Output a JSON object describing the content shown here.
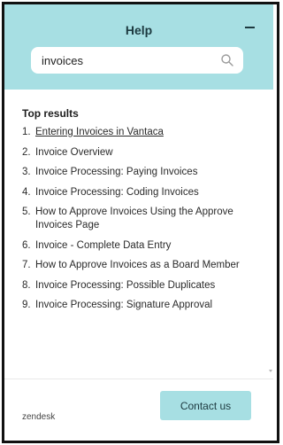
{
  "widget": {
    "title": "Help",
    "minimize_icon": "minus-icon"
  },
  "search": {
    "value": "invoices",
    "icon": "search-icon"
  },
  "results": {
    "heading": "Top results",
    "items": [
      {
        "number": "1.",
        "label": "Entering Invoices in Vantaca"
      },
      {
        "number": "2.",
        "label": "Invoice Overview"
      },
      {
        "number": "3.",
        "label": "Invoice Processing: Paying Invoices"
      },
      {
        "number": "4.",
        "label": "Invoice Processing: Coding Invoices"
      },
      {
        "number": "5.",
        "label": "How to Approve Invoices Using the Approve Invoices Page"
      },
      {
        "number": "6.",
        "label": "Invoice - Complete Data Entry"
      },
      {
        "number": "7.",
        "label": "How to Approve Invoices as a Board Member"
      },
      {
        "number": "8.",
        "label": "Invoice Processing: Possible Duplicates"
      },
      {
        "number": "9.",
        "label": "Invoice Processing: Signature Approval"
      }
    ]
  },
  "footer": {
    "brand": "zendesk",
    "contact_label": "Contact us"
  },
  "colors": {
    "accent": "#a7dfe3",
    "text": "#1d3a40"
  }
}
